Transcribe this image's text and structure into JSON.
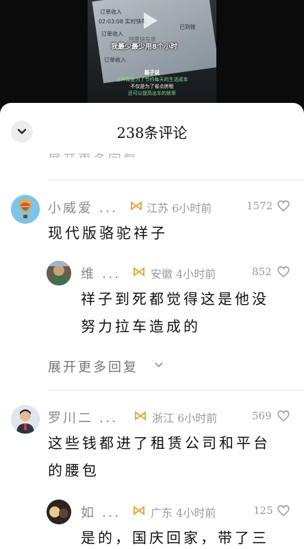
{
  "video": {
    "receipt_line_1": "订单收入",
    "receipt_line_2": "02:03:08 实时快车",
    "receipt_line_3": "订单收入",
    "receipt_line_4": "特惠快车单",
    "receipt_line_5": "订单收入",
    "receipt_line_6": "已到账",
    "subtitle": "我最少最少用8个小时",
    "caption_name": "磊子说",
    "caption_line_1": "这样做是为了节约每天的生活成本",
    "caption_line_2": "不仅是为了省点房租",
    "caption_line_3": "还可以提高出车的效率"
  },
  "sheet": {
    "title": "238条评论",
    "faded_previous": "展开更多回复"
  },
  "comments": [
    {
      "name": "小威爱 ...",
      "location": "江苏 6小时前",
      "likes": "1572",
      "text": "现代版骆驼祥子",
      "reply": {
        "name": "维 ...",
        "location": "安徽 4小时前",
        "likes": "852",
        "text_line_1": "祥子到死都觉得这是他没",
        "text_line_2": "努力拉车造成的"
      },
      "expand_label": "展开更多回复"
    },
    {
      "name": "罗川二 ...",
      "location": "浙江 6小时前",
      "likes": "569",
      "text_line_1": "这些钱都进了租赁公司和平台",
      "text_line_2": "的腰包",
      "reply": {
        "name": "如 ...",
        "location": "广东 4小时前",
        "likes": "125",
        "text_line_1": "是的，国庆回家，带了三"
      }
    }
  ],
  "colors": {
    "badge": "#e9a93a",
    "meta": "#9a9a9a",
    "text": "#111111"
  }
}
